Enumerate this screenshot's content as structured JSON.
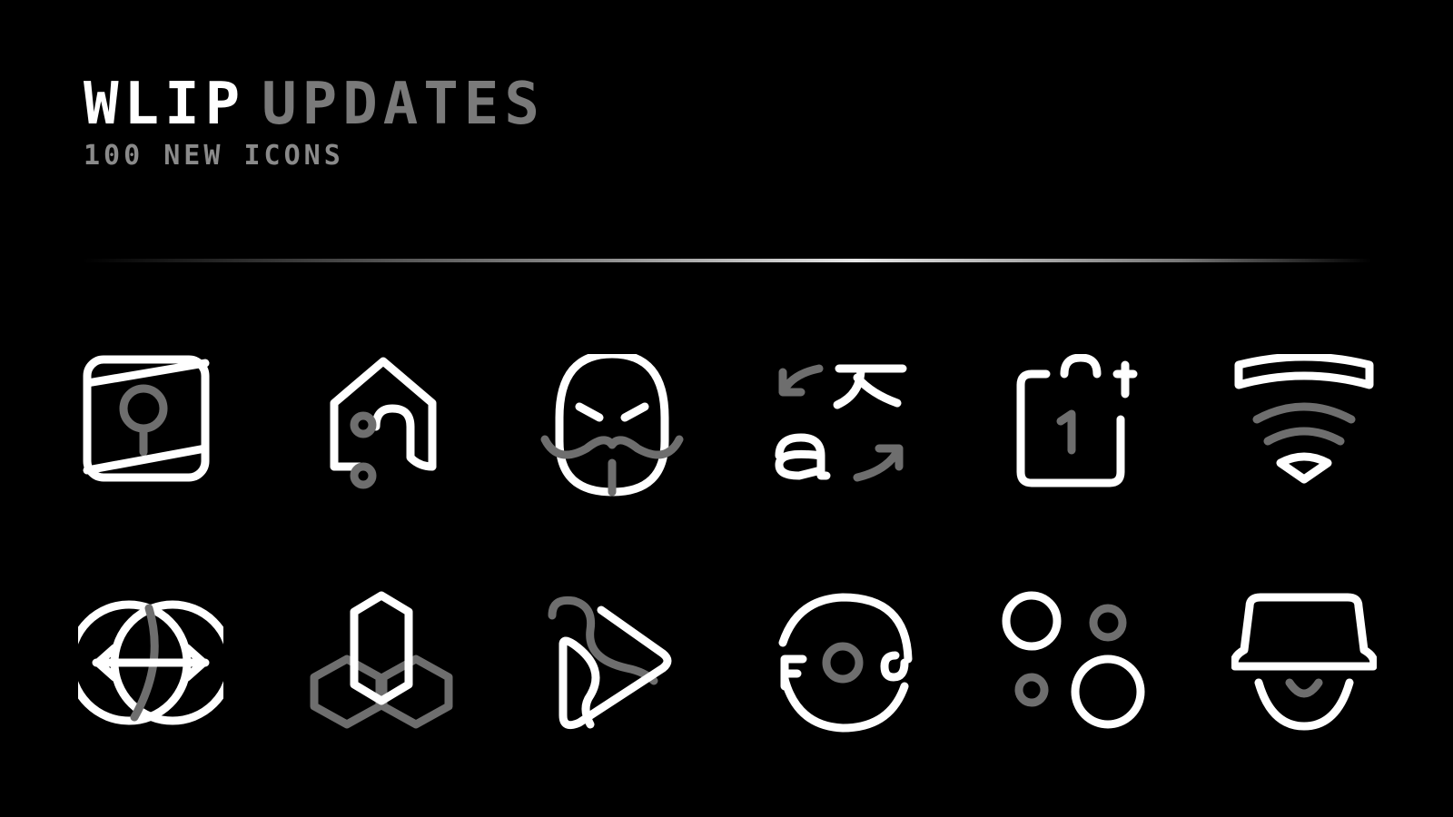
{
  "header": {
    "title_primary": "WLIP",
    "title_secondary": "UPDATES",
    "subtitle": "100 NEW ICONS"
  },
  "colors": {
    "background": "#000000",
    "primary": "#ffffff",
    "secondary": "#7a7a7a"
  },
  "logo": {
    "icon": "brand-logo-icon"
  },
  "icons": [
    {
      "name": "gallery-tree-icon"
    },
    {
      "name": "home-route-icon"
    },
    {
      "name": "mustache-face-icon"
    },
    {
      "name": "translate-icon"
    },
    {
      "name": "calendar-add-icon"
    },
    {
      "name": "wifi-icon"
    },
    {
      "name": "transfer-globe-icon"
    },
    {
      "name": "hexagon-stack-icon"
    },
    {
      "name": "play-ribbon-icon"
    },
    {
      "name": "face-circle-icon"
    },
    {
      "name": "bubbles-icon"
    },
    {
      "name": "spy-hat-icon"
    }
  ]
}
